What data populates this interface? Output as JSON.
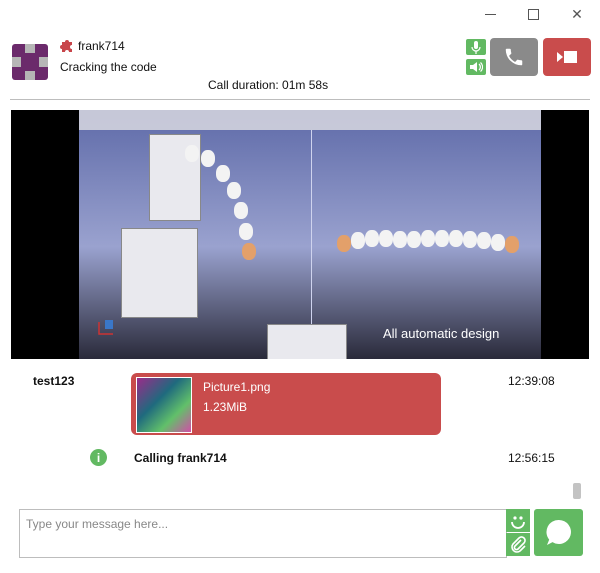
{
  "window": {
    "minimize_icon": "minimize-icon",
    "maximize_icon": "maximize-icon",
    "close_icon": "close-icon"
  },
  "contact": {
    "name": "frank714",
    "status": "Cracking the code",
    "presence_icon": "puzzle-icon",
    "brand_color": "#6b2a6b"
  },
  "call": {
    "duration": "Call duration: 01m 58s",
    "mic_icon": "microphone-icon",
    "speaker_icon": "speaker-icon",
    "call_icon": "phone-icon",
    "end_icon": "video-end-icon",
    "accent_green": "#62b962",
    "accent_red": "#c94c4c"
  },
  "video": {
    "caption": "All automatic design"
  },
  "messages": [
    {
      "sender": "test123",
      "file_name": "Picture1.png",
      "file_size": "1.23MiB",
      "time": "12:39:08"
    },
    {
      "icon": "info-icon",
      "text": "Calling frank714",
      "time": "12:56:15"
    }
  ],
  "composer": {
    "placeholder": "Type your message here...",
    "emoji_icon": "smiley-icon",
    "attach_icon": "paperclip-icon",
    "send_icon": "send-bubble-icon"
  }
}
